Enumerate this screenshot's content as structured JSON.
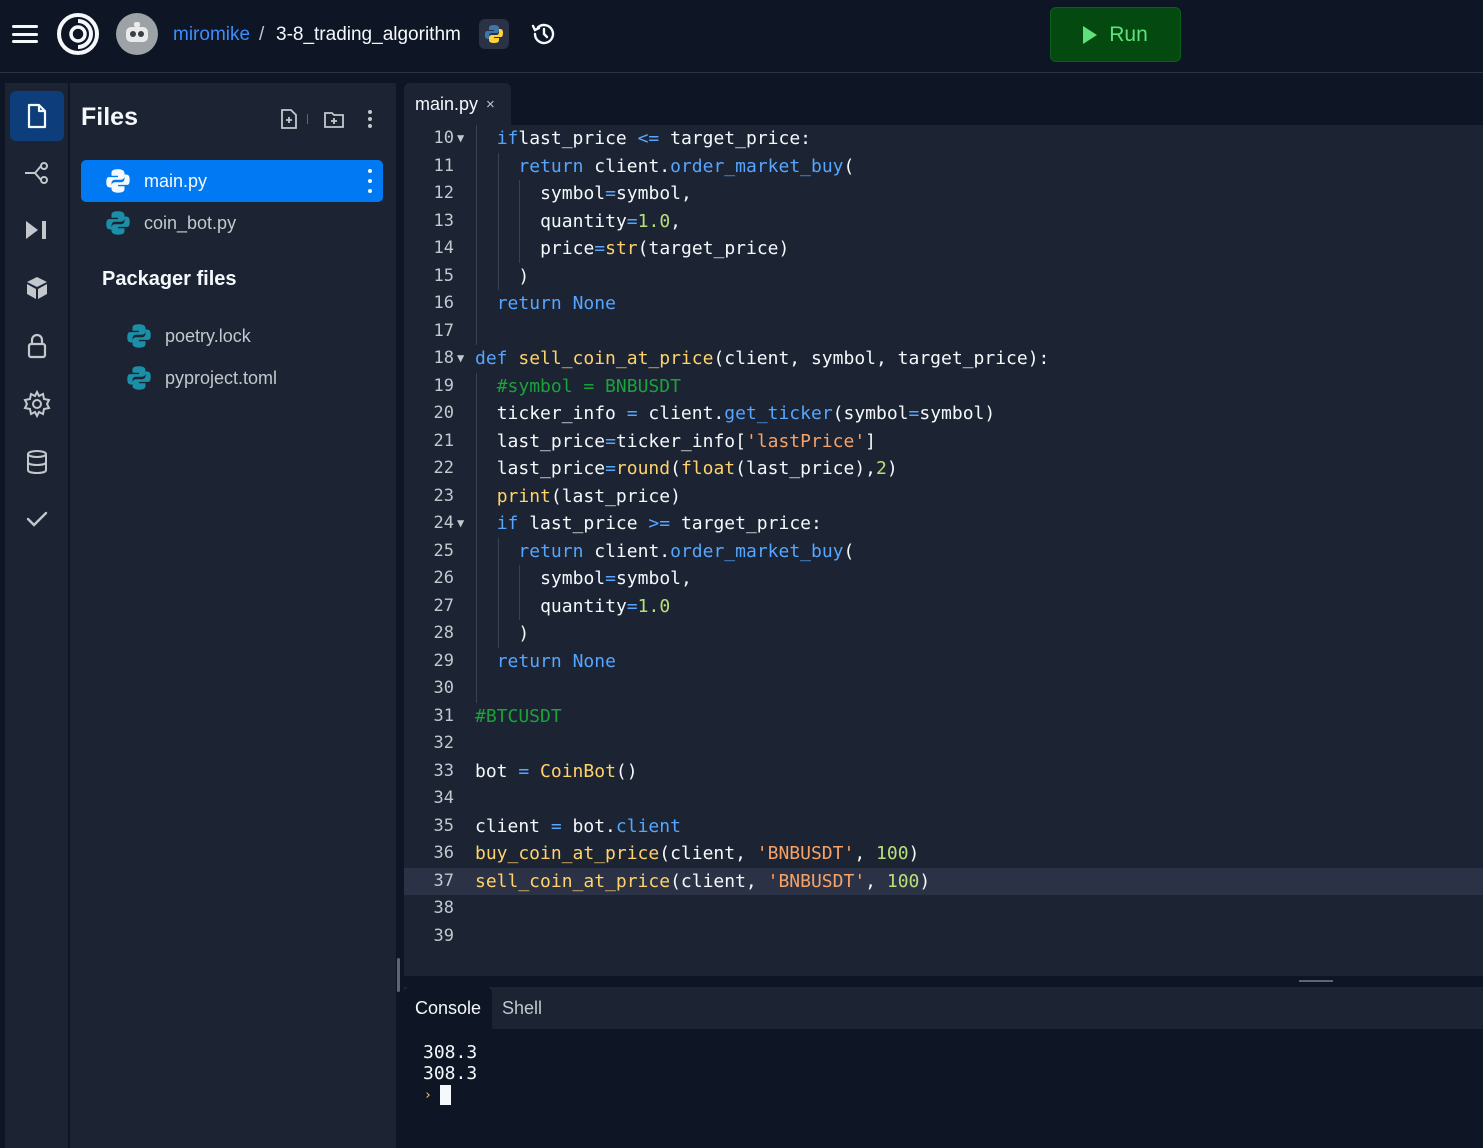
{
  "topbar": {
    "username": "miromike",
    "separator": "/",
    "repl_name": "3-8_trading_algorithm",
    "run_label": "Run",
    "icons": [
      "hamburger-icon",
      "replit-logo-icon",
      "avatar",
      "python-icon",
      "history-icon",
      "play-icon"
    ]
  },
  "rail": {
    "items": [
      "files-icon",
      "git-icon",
      "debugger-icon",
      "packages-icon",
      "secrets-icon",
      "settings-icon",
      "database-icon",
      "unit-tests-icon"
    ]
  },
  "files_panel": {
    "title": "Files",
    "files": [
      {
        "name": "main.py",
        "active": true
      },
      {
        "name": "coin_bot.py",
        "active": false
      }
    ],
    "packager_title": "Packager files",
    "packager_files": [
      {
        "name": "poetry.lock"
      },
      {
        "name": "pyproject.toml"
      }
    ]
  },
  "editor": {
    "tab_label": "main.py",
    "tab_close": "×",
    "current_line": 37,
    "lines": [
      {
        "n": "10",
        "fold": "▼",
        "indent": 1,
        "tokens": [
          [
            "kw",
            "if"
          ],
          [
            "",
            "last_price "
          ],
          [
            "op",
            "<="
          ],
          [
            "",
            " target_price:"
          ]
        ]
      },
      {
        "n": "11",
        "fold": "",
        "indent": 2,
        "tokens": [
          [
            "kw",
            "return"
          ],
          [
            "",
            " client."
          ],
          [
            "mth",
            "order_market_buy"
          ],
          [
            "",
            "("
          ]
        ]
      },
      {
        "n": "12",
        "fold": "",
        "indent": 3,
        "tokens": [
          [
            "",
            "symbol"
          ],
          [
            "op",
            "="
          ],
          [
            "",
            "symbol,"
          ]
        ]
      },
      {
        "n": "13",
        "fold": "",
        "indent": 3,
        "tokens": [
          [
            "",
            "quantity"
          ],
          [
            "op",
            "="
          ],
          [
            "num",
            "1.0"
          ],
          [
            "",
            ","
          ]
        ]
      },
      {
        "n": "14",
        "fold": "",
        "indent": 3,
        "tokens": [
          [
            "",
            "price"
          ],
          [
            "op",
            "="
          ],
          [
            "bi",
            "str"
          ],
          [
            "",
            "(target_price)"
          ]
        ]
      },
      {
        "n": "15",
        "fold": "",
        "indent": 2,
        "tokens": [
          [
            "",
            ")"
          ]
        ]
      },
      {
        "n": "16",
        "fold": "",
        "indent": 1,
        "tokens": [
          [
            "kw",
            "return"
          ],
          [
            "",
            " "
          ],
          [
            "kw",
            "None"
          ]
        ]
      },
      {
        "n": "17",
        "fold": "",
        "indent": 1,
        "tokens": []
      },
      {
        "n": "18",
        "fold": "▼",
        "indent": 0,
        "tokens": [
          [
            "kw",
            "def"
          ],
          [
            "",
            " "
          ],
          [
            "fn",
            "sell_coin_at_price"
          ],
          [
            "",
            "(client, symbol, target_price):"
          ]
        ]
      },
      {
        "n": "19",
        "fold": "",
        "indent": 1,
        "tokens": [
          [
            "cmt",
            "#symbol = BNBUSDT"
          ]
        ]
      },
      {
        "n": "20",
        "fold": "",
        "indent": 1,
        "tokens": [
          [
            "",
            "ticker_info "
          ],
          [
            "op",
            "="
          ],
          [
            "",
            " client."
          ],
          [
            "mth",
            "get_ticker"
          ],
          [
            "",
            "(symbol"
          ],
          [
            "op",
            "="
          ],
          [
            "",
            "symbol)"
          ]
        ]
      },
      {
        "n": "21",
        "fold": "",
        "indent": 1,
        "tokens": [
          [
            "",
            "last_price"
          ],
          [
            "op",
            "="
          ],
          [
            "",
            "ticker_info["
          ],
          [
            "str",
            "'lastPrice'"
          ],
          [
            "",
            "]"
          ]
        ]
      },
      {
        "n": "22",
        "fold": "",
        "indent": 1,
        "tokens": [
          [
            "",
            "last_price"
          ],
          [
            "op",
            "="
          ],
          [
            "bi",
            "round"
          ],
          [
            "",
            "("
          ],
          [
            "bi",
            "float"
          ],
          [
            "",
            "(last_price),"
          ],
          [
            "num",
            "2"
          ],
          [
            "",
            ")"
          ]
        ]
      },
      {
        "n": "23",
        "fold": "",
        "indent": 1,
        "tokens": [
          [
            "bi",
            "print"
          ],
          [
            "",
            "(last_price)"
          ]
        ]
      },
      {
        "n": "24",
        "fold": "▼",
        "indent": 1,
        "tokens": [
          [
            "kw",
            "if"
          ],
          [
            "",
            " last_price "
          ],
          [
            "op",
            ">="
          ],
          [
            "",
            " target_price:"
          ]
        ]
      },
      {
        "n": "25",
        "fold": "",
        "indent": 2,
        "tokens": [
          [
            "kw",
            "return"
          ],
          [
            "",
            " client."
          ],
          [
            "mth",
            "order_market_buy"
          ],
          [
            "",
            "("
          ]
        ]
      },
      {
        "n": "26",
        "fold": "",
        "indent": 3,
        "tokens": [
          [
            "",
            "symbol"
          ],
          [
            "op",
            "="
          ],
          [
            "",
            "symbol,"
          ]
        ]
      },
      {
        "n": "27",
        "fold": "",
        "indent": 3,
        "tokens": [
          [
            "",
            "quantity"
          ],
          [
            "op",
            "="
          ],
          [
            "num",
            "1.0"
          ]
        ]
      },
      {
        "n": "28",
        "fold": "",
        "indent": 2,
        "tokens": [
          [
            "",
            ")"
          ]
        ]
      },
      {
        "n": "29",
        "fold": "",
        "indent": 1,
        "tokens": [
          [
            "kw",
            "return"
          ],
          [
            "",
            " "
          ],
          [
            "kw",
            "None"
          ]
        ]
      },
      {
        "n": "30",
        "fold": "",
        "indent": 1,
        "tokens": []
      },
      {
        "n": "31",
        "fold": "",
        "indent": 0,
        "tokens": [
          [
            "cmt",
            "#BTCUSDT"
          ]
        ]
      },
      {
        "n": "32",
        "fold": "",
        "indent": 0,
        "tokens": []
      },
      {
        "n": "33",
        "fold": "",
        "indent": 0,
        "tokens": [
          [
            "",
            "bot "
          ],
          [
            "op",
            "="
          ],
          [
            "",
            " "
          ],
          [
            "fn",
            "CoinBot"
          ],
          [
            "",
            "()"
          ]
        ]
      },
      {
        "n": "34",
        "fold": "",
        "indent": 0,
        "tokens": []
      },
      {
        "n": "35",
        "fold": "",
        "indent": 0,
        "tokens": [
          [
            "",
            "client "
          ],
          [
            "op",
            "="
          ],
          [
            "",
            " bot."
          ],
          [
            "mth",
            "client"
          ]
        ]
      },
      {
        "n": "36",
        "fold": "",
        "indent": 0,
        "tokens": [
          [
            "fn",
            "buy_coin_at_price"
          ],
          [
            "",
            "(client, "
          ],
          [
            "str",
            "'BNBUSDT'"
          ],
          [
            "",
            ", "
          ],
          [
            "num",
            "100"
          ],
          [
            "",
            ")"
          ]
        ]
      },
      {
        "n": "37",
        "fold": "",
        "indent": 0,
        "tokens": [
          [
            "fn",
            "sell_coin_at_price"
          ],
          [
            "",
            "(client, "
          ],
          [
            "str",
            "'BNBUSDT'"
          ],
          [
            "",
            ", "
          ],
          [
            "num",
            "100"
          ],
          [
            "",
            ")"
          ]
        ]
      },
      {
        "n": "38",
        "fold": "",
        "indent": 0,
        "tokens": []
      },
      {
        "n": "39",
        "fold": "",
        "indent": 0,
        "tokens": []
      }
    ]
  },
  "console": {
    "tabs": [
      "Console",
      "Shell"
    ],
    "active_tab": "Console",
    "output": [
      "308.3",
      "308.3"
    ],
    "prompt": "›"
  },
  "colors": {
    "accent": "#0079f2",
    "run_green": "#044a10",
    "background": "#0e1525",
    "surface": "#1c2333"
  }
}
